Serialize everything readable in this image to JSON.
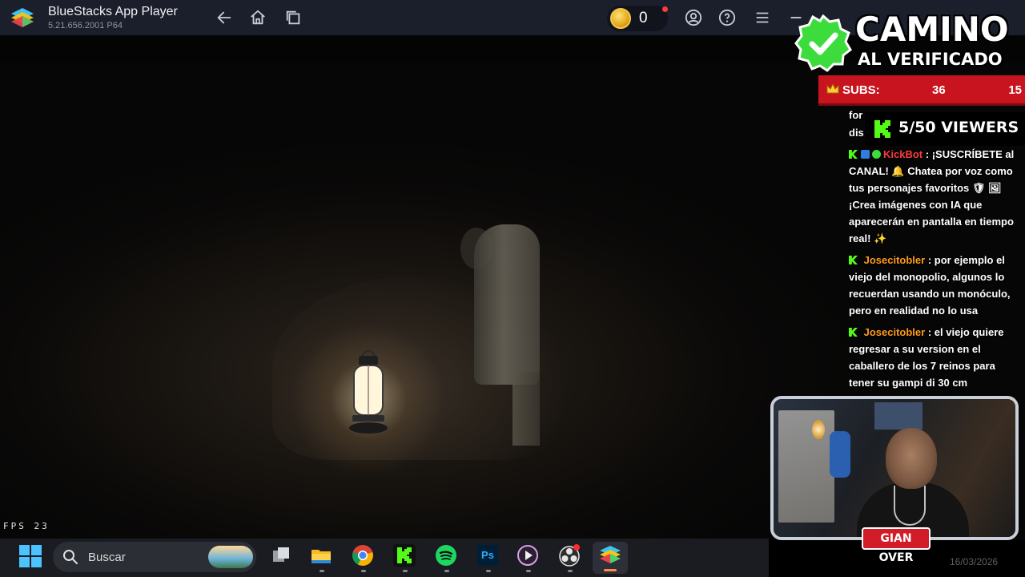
{
  "titlebar": {
    "app_name": "BlueStacks App Player",
    "version": "5.21.656.2001 P64",
    "coin_count": "0"
  },
  "video": {
    "fps_label": "FPS  23"
  },
  "overlay": {
    "title_line1": "CAMINO",
    "title_line2": "AL VERIFICADO",
    "subs_label": "SUBS:",
    "subs_count": "36",
    "subs_goal": "15",
    "viewers": "5/50 VIEWERS",
    "colors": {
      "subs_bar": "#c8141e",
      "kick_green": "#53fc18",
      "badge_green": "#3ddc3d"
    }
  },
  "chat": {
    "fragment_1": "for",
    "fragment_2": "dis",
    "messages": [
      {
        "user": "KickBot",
        "separator": " : ",
        "text": "¡SUSCRÍBETE al CANAL! 🔔 Chatea por voz como tus personajes favoritos 🛡 🖼 ¡Crea imágenes con IA que aparecerán en pantalla en tiempo real! ✨"
      },
      {
        "user": "Josecitobler",
        "separator": " : ",
        "text": "por ejemplo el viejo del monopolio, algunos lo recuerdan usando un monóculo, pero en realidad no lo usa"
      },
      {
        "user": "Josecitobler",
        "separator": " : ",
        "text": "el viejo quiere regresar a su version en el caballero de los 7 reinos para tener su gampi di 30 cm"
      }
    ]
  },
  "webcam": {
    "name_tag": "GIAN OVER",
    "date": "16/03/2026"
  },
  "taskbar": {
    "search_placeholder": "Buscar",
    "apps": [
      "task-view-icon",
      "file-explorer-icon",
      "chrome-icon",
      "kick-icon",
      "spotify-icon",
      "photoshop-icon",
      "media-player-icon",
      "obs-icon",
      "bluestacks-icon"
    ],
    "photoshop_label": "Ps"
  }
}
